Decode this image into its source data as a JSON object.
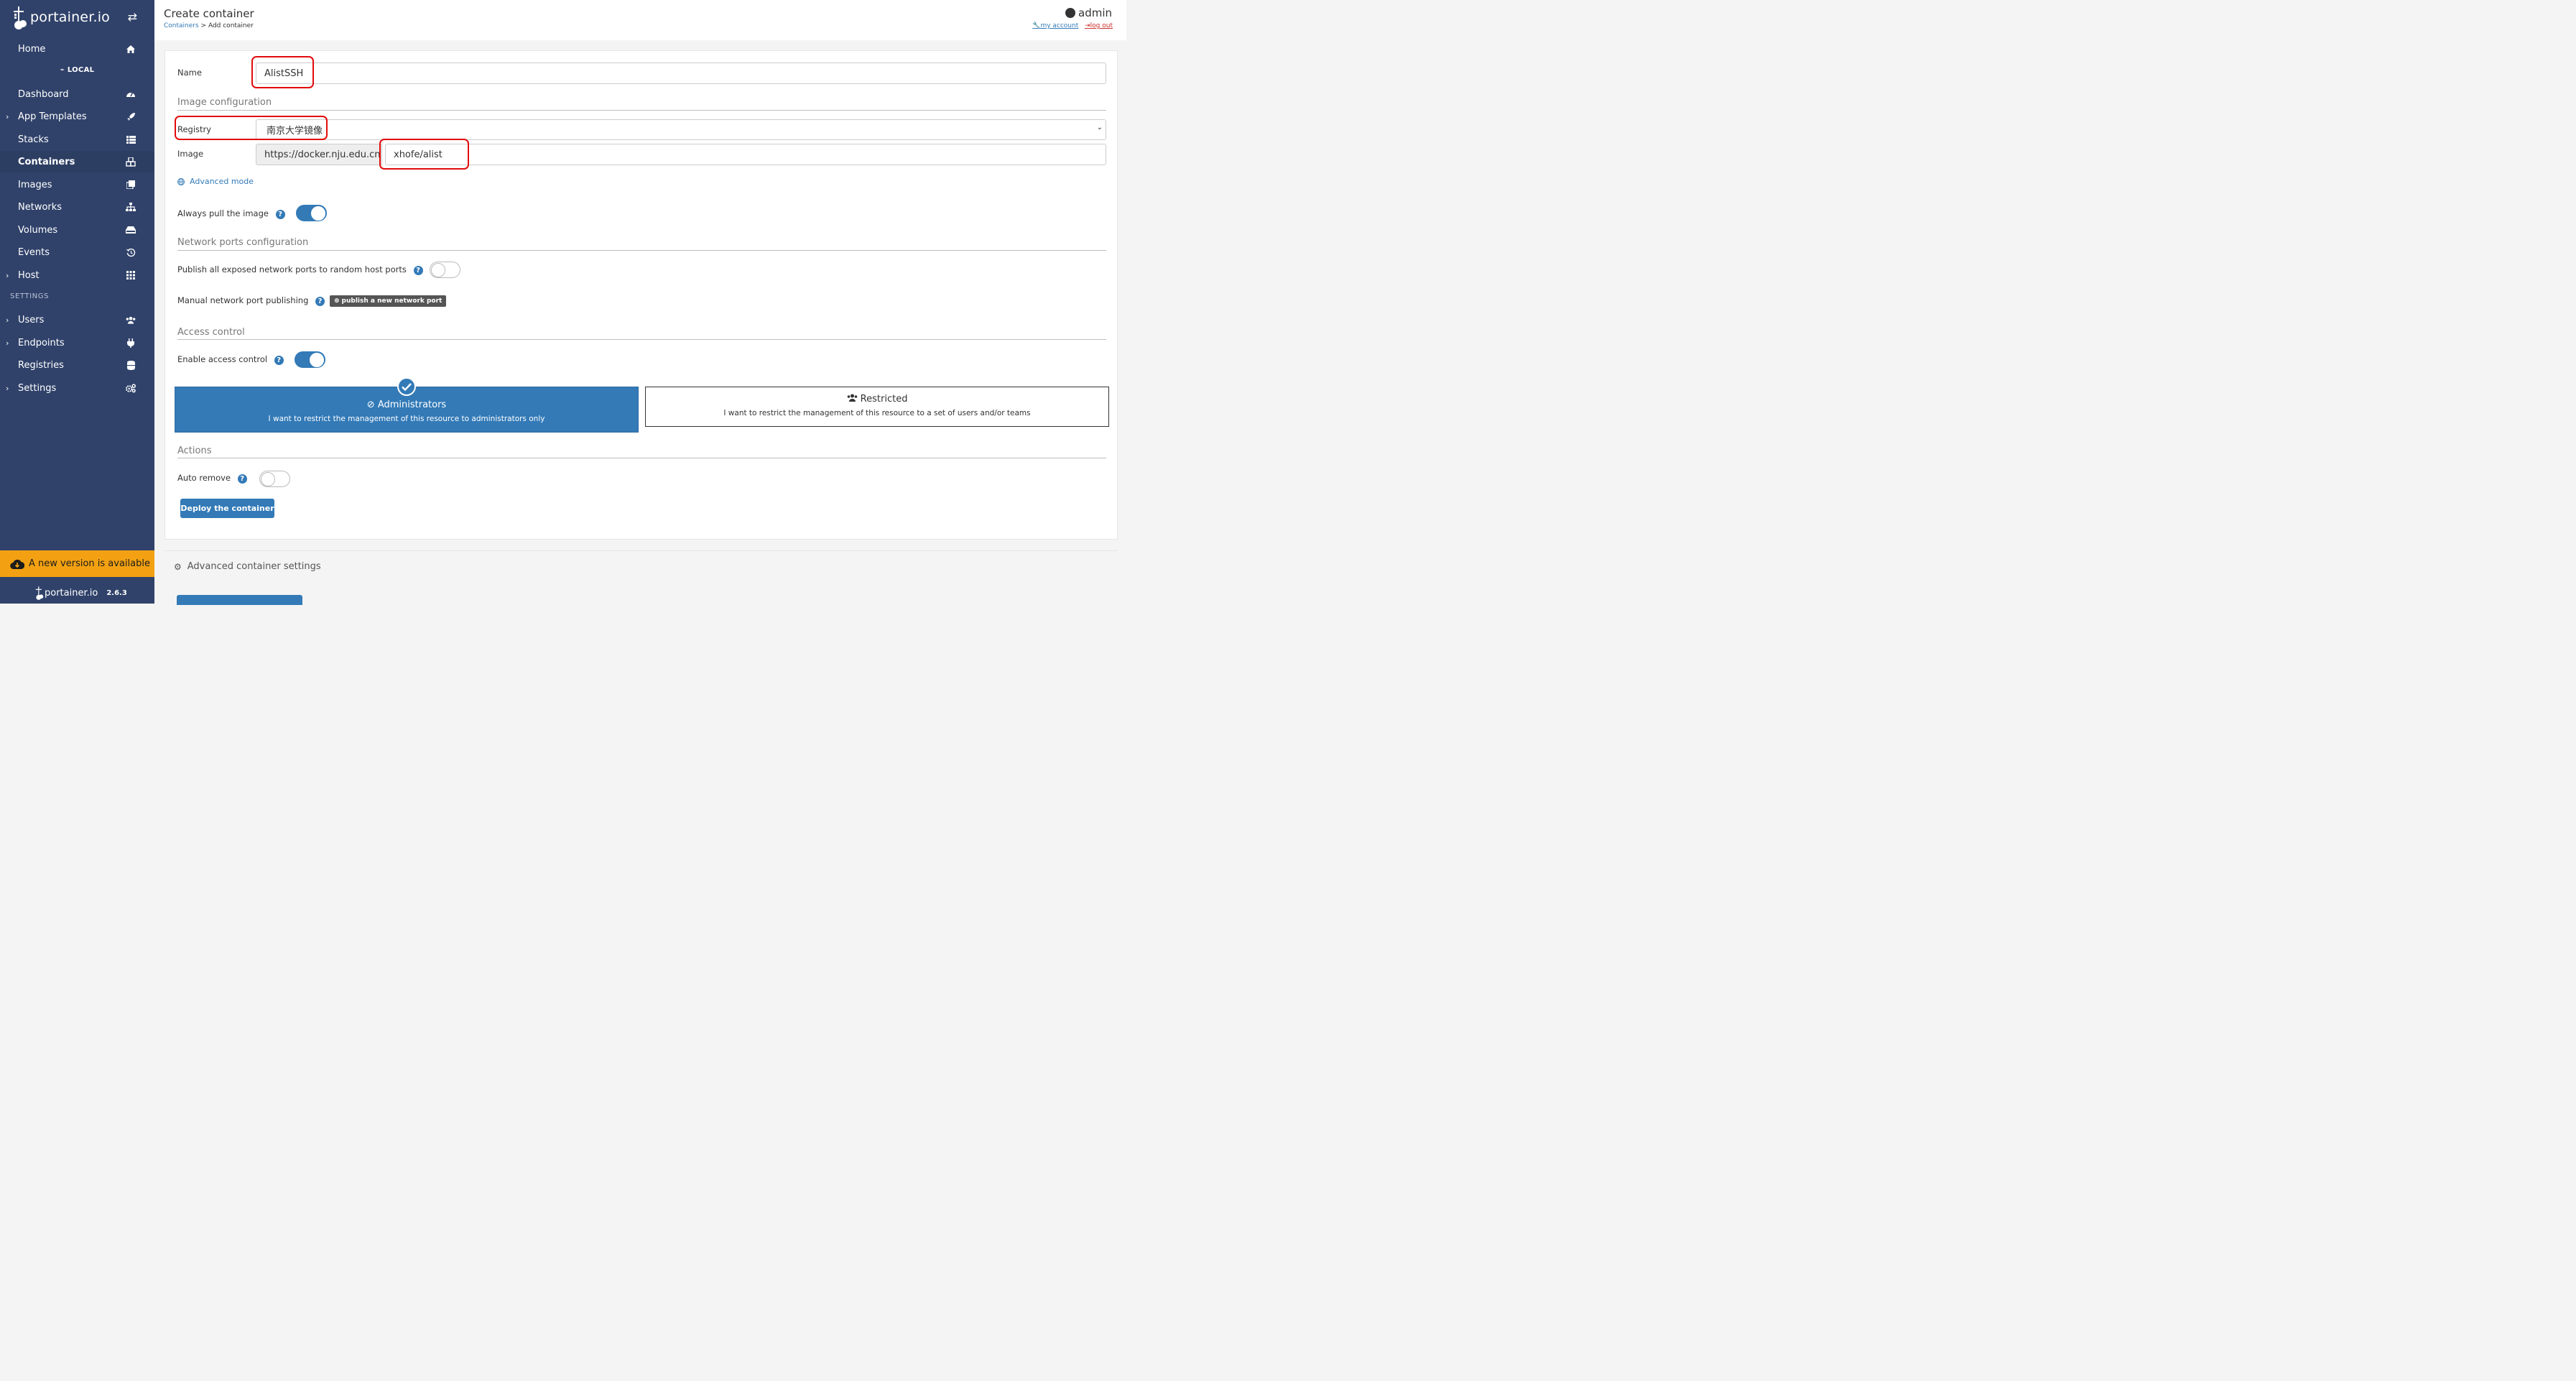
{
  "app": {
    "brand": "portainer.io",
    "version": "2.6.3",
    "update_banner": "A new version is available"
  },
  "sidebar": {
    "home": "Home",
    "endpoint_label": "LOCAL",
    "items": [
      {
        "label": "Dashboard",
        "icon": "dashboard-icon",
        "expandable": false
      },
      {
        "label": "App Templates",
        "icon": "rocket-icon",
        "expandable": true
      },
      {
        "label": "Stacks",
        "icon": "list-icon",
        "expandable": false
      },
      {
        "label": "Containers",
        "icon": "cubes-icon",
        "expandable": false,
        "active": true
      },
      {
        "label": "Images",
        "icon": "clone-icon",
        "expandable": false
      },
      {
        "label": "Networks",
        "icon": "sitemap-icon",
        "expandable": false
      },
      {
        "label": "Volumes",
        "icon": "hdd-icon",
        "expandable": false
      },
      {
        "label": "Events",
        "icon": "history-icon",
        "expandable": false
      },
      {
        "label": "Host",
        "icon": "th-icon",
        "expandable": true
      }
    ],
    "settings_heading": "SETTINGS",
    "settings_items": [
      {
        "label": "Users",
        "icon": "users-icon",
        "expandable": true
      },
      {
        "label": "Endpoints",
        "icon": "plug-icon",
        "expandable": true
      },
      {
        "label": "Registries",
        "icon": "database-icon",
        "expandable": false
      },
      {
        "label": "Settings",
        "icon": "cogs-icon",
        "expandable": true
      }
    ]
  },
  "header": {
    "title": "Create container",
    "breadcrumb_link": "Containers",
    "breadcrumb_rest": "> Add container",
    "user": "admin",
    "my_account": "my account",
    "log_out": "log out"
  },
  "form": {
    "name_label": "Name",
    "name_value": "AlistSSH",
    "image_config_title": "Image configuration",
    "registry_label": "Registry",
    "registry_value": "南京大学镜像",
    "image_label": "Image",
    "image_prefix": "https://docker.nju.edu.cn",
    "image_value": "xhofe/alist",
    "advanced_mode": "Advanced mode",
    "always_pull_label": "Always pull the image",
    "always_pull_on": true,
    "network_title": "Network ports configuration",
    "publish_all_label": "Publish all exposed network ports to random host ports",
    "publish_all_on": false,
    "manual_publish_label": "Manual network port publishing",
    "publish_new_btn": "publish a new network port",
    "access_title": "Access control",
    "enable_access_label": "Enable access control",
    "enable_access_on": true,
    "admin_card_title": "Administrators",
    "admin_card_desc": "I want to restrict the management of this resource to administrators only",
    "restricted_card_title": "Restricted",
    "restricted_card_desc": "I want to restrict the management of this resource to a set of users and/or teams",
    "actions_title": "Actions",
    "auto_remove_label": "Auto remove",
    "auto_remove_on": false,
    "deploy_btn": "Deploy the container"
  },
  "advanced": {
    "title": "Advanced container settings"
  },
  "colors": {
    "sidebar_bg": "#30426a",
    "accent": "#337ab7",
    "banner": "#f3a112",
    "highlight_box": "#e20b0b"
  }
}
